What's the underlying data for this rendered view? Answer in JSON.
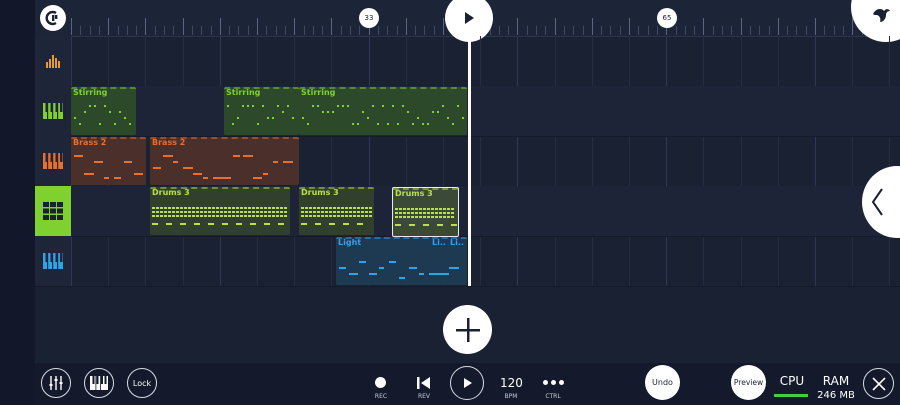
{
  "colors": {
    "green": "#7fd12f",
    "orange": "#e8702a",
    "lightgreen": "#a8d84b",
    "blue": "#2fa3e8",
    "bg": "#1a2133"
  },
  "ruler": {
    "marker_a": "33",
    "marker_b": "65"
  },
  "tracks": [
    {
      "icon": "level-meter-icon",
      "color": "#e89a2a"
    },
    {
      "icon": "keyboard-icon",
      "color": "#7fd12f"
    },
    {
      "icon": "keyboard-icon",
      "color": "#e8702a"
    },
    {
      "icon": "drum-pads-icon",
      "color": "#1a2133"
    },
    {
      "icon": "keyboard-icon",
      "color": "#2fa3e8"
    }
  ],
  "clips": {
    "stirring_1": "Stirring",
    "stirring_2": "Stirring",
    "stirring_3": "Stirring",
    "brass_1": "Brass 2",
    "brass_2": "Brass 2",
    "drums_1": "Drums 3",
    "drums_2": "Drums 3",
    "drums_3": "Drums 3",
    "light_1": "Light",
    "light_2": "Li..",
    "light_3": "Li.."
  },
  "bottom": {
    "lock": "Lock",
    "rec": "REC",
    "rev": "REV",
    "bpm_value": "120",
    "bpm": "BPM",
    "ctrl": "CTRL",
    "undo": "Undo",
    "preview": "Preview",
    "cpu": "CPU",
    "ram": "RAM",
    "ram_value": "246 MB"
  }
}
